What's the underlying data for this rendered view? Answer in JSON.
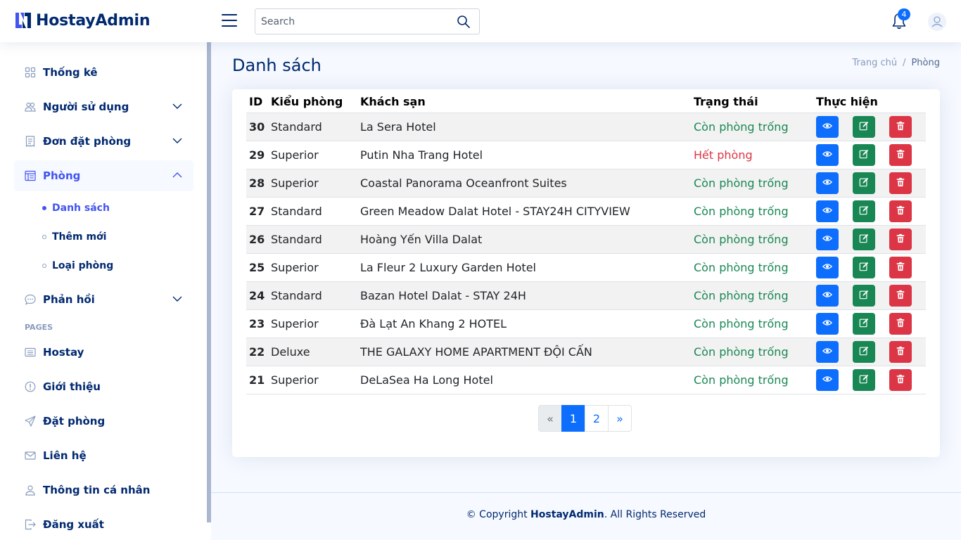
{
  "header": {
    "brand": "HostayAdmin",
    "search_placeholder": "Search",
    "notification_count": "4"
  },
  "sidebar": {
    "items": [
      {
        "label": "Thống kê",
        "icon": "grid-icon"
      },
      {
        "label": "Người sử dụng",
        "icon": "people-icon"
      },
      {
        "label": "Đơn đặt phòng",
        "icon": "receipt-icon"
      },
      {
        "label": "Phòng",
        "icon": "layout-icon"
      },
      {
        "label": "Phản hồi",
        "icon": "chat-icon"
      }
    ],
    "subitems": [
      {
        "label": "Danh sách"
      },
      {
        "label": "Thêm mới"
      },
      {
        "label": "Loại phòng"
      }
    ],
    "pages_heading": "PAGES",
    "pages": [
      {
        "label": "Hostay",
        "icon": "card-list-icon"
      },
      {
        "label": "Giới thiệu",
        "icon": "info-icon"
      },
      {
        "label": "Đặt phòng",
        "icon": "send-icon"
      },
      {
        "label": "Liên hệ",
        "icon": "envelope-icon"
      },
      {
        "label": "Thông tin cá nhân",
        "icon": "person-icon"
      },
      {
        "label": "Đăng xuất",
        "icon": "logout-icon"
      }
    ]
  },
  "main": {
    "title": "Danh sách",
    "breadcrumb": {
      "home": "Trang chủ",
      "separator": "/",
      "current": "Phòng"
    }
  },
  "table": {
    "headers": [
      "ID",
      "Kiểu phòng",
      "Khách sạn",
      "Trạng thái",
      "Thực hiện"
    ],
    "rows": [
      {
        "id": "30",
        "type": "Standard",
        "hotel": "La Sera Hotel",
        "status": "Còn phòng trống"
      },
      {
        "id": "29",
        "type": "Superior",
        "hotel": "Putin Nha Trang Hotel",
        "status": "Hết phòng"
      },
      {
        "id": "28",
        "type": "Superior",
        "hotel": "Coastal Panorama Oceanfront Suites",
        "status": "Còn phòng trống"
      },
      {
        "id": "27",
        "type": "Standard",
        "hotel": "Green Meadow Dalat Hotel - STAY24H CITYVIEW",
        "status": "Còn phòng trống"
      },
      {
        "id": "26",
        "type": "Standard",
        "hotel": "Hoàng Yến Villa Dalat",
        "status": "Còn phòng trống"
      },
      {
        "id": "25",
        "type": "Superior",
        "hotel": "La Fleur 2 Luxury Garden Hotel",
        "status": "Còn phòng trống"
      },
      {
        "id": "24",
        "type": "Standard",
        "hotel": "Bazan Hotel Dalat - STAY 24H",
        "status": "Còn phòng trống"
      },
      {
        "id": "23",
        "type": "Superior",
        "hotel": "Đà Lạt An Khang 2 HOTEL",
        "status": "Còn phòng trống"
      },
      {
        "id": "22",
        "type": "Deluxe",
        "hotel": "THE GALAXY HOME APARTMENT ĐỘI CẤN",
        "status": "Còn phòng trống"
      },
      {
        "id": "21",
        "type": "Superior",
        "hotel": "DeLaSea Ha Long Hotel",
        "status": "Còn phòng trống"
      }
    ]
  },
  "pagination": {
    "prev": "«",
    "pages": [
      "1",
      "2"
    ],
    "next": "»",
    "current": "1"
  },
  "footer": {
    "prefix": "© Copyright ",
    "brand": "HostayAdmin",
    "suffix": ". All Rights Reserved"
  },
  "colors": {
    "brand": "#012970",
    "accent": "#4154f1",
    "primary": "#0d6efd",
    "success": "#198754",
    "danger": "#dc3545"
  }
}
